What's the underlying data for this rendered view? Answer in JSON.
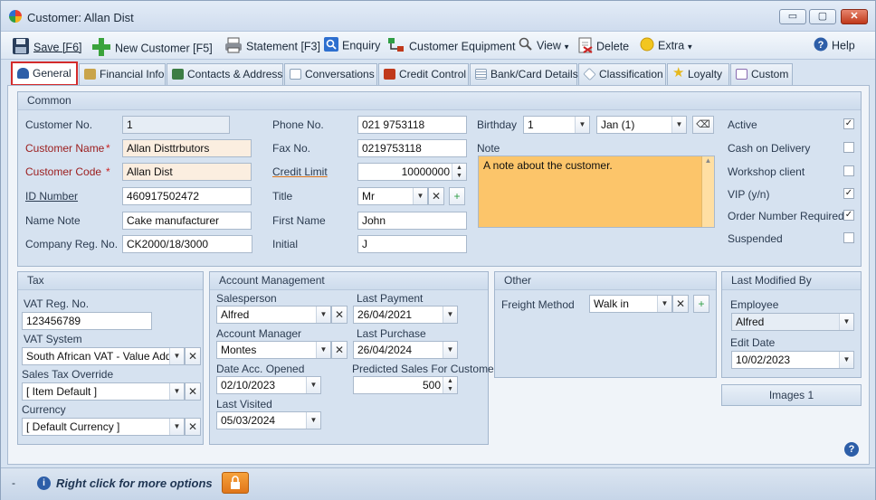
{
  "window": {
    "title": "Customer: Allan Dist",
    "minimize": "▭",
    "maximize": "▢",
    "close": "✕"
  },
  "toolbar": {
    "save": "Save [F6]",
    "new_customer": "New Customer [F5]",
    "statement": "Statement [F3]",
    "enquiry": "Enquiry",
    "customer_equipment": "Customer Equipment",
    "view": "View",
    "delete": "Delete",
    "extra": "Extra",
    "help": "Help"
  },
  "tabs": [
    {
      "label": "General",
      "icon": "person-icon",
      "color": "#2d5ea8"
    },
    {
      "label": "Financial Info",
      "icon": "building-icon",
      "color": "#c9a44a"
    },
    {
      "label": "Contacts & Address",
      "icon": "map-icon",
      "color": "#3c7d44"
    },
    {
      "label": "Conversations",
      "icon": "chat-icon",
      "color": "#8aa0b8"
    },
    {
      "label": "Credit Control",
      "icon": "lock-icon",
      "color": "#c0391b"
    },
    {
      "label": "Bank/Card Details",
      "icon": "grid-icon",
      "color": "#8aa0b8"
    },
    {
      "label": "Classification",
      "icon": "tag-icon",
      "color": "#8aa0b8"
    },
    {
      "label": "Loyalty",
      "icon": "star-icon",
      "color": "#e6b81c"
    },
    {
      "label": "Custom",
      "icon": "custom-icon",
      "color": "#8a6bb0"
    }
  ],
  "common": {
    "title": "Common",
    "customer_no_label": "Customer No.",
    "customer_no": "1",
    "customer_name_label": "Customer Name",
    "customer_name": "Allan Disttrbutors",
    "customer_code_label": "Customer Code",
    "customer_code": "Allan Dist",
    "id_number_label": "ID Number",
    "id_number": "460917502472",
    "name_note_label": "Name Note",
    "name_note": "Cake manufacturer",
    "company_reg_label": "Company Reg. No.",
    "company_reg": "CK2000/18/3000",
    "phone_label": "Phone No.",
    "phone": "021 9753118",
    "fax_label": "Fax No.",
    "fax": "0219753118",
    "credit_limit_label": "Credit Limit",
    "credit_limit": "10000000",
    "title_label": "Title",
    "title_value": "Mr",
    "first_name_label": "First Name",
    "first_name": "John",
    "initial_label": "Initial",
    "initial": "J",
    "birthday_label": "Birthday",
    "birthday_day": "1",
    "birthday_month": "Jan (1)",
    "note_label": "Note",
    "note": "A note about the customer.",
    "flags": [
      {
        "label": "Active",
        "checked": true
      },
      {
        "label": "Cash on Delivery",
        "checked": false
      },
      {
        "label": "Workshop client",
        "checked": false
      },
      {
        "label": "VIP (y/n)",
        "checked": true
      },
      {
        "label": "Order Number Required",
        "checked": true
      },
      {
        "label": "Suspended",
        "checked": false
      }
    ]
  },
  "tax": {
    "title": "Tax",
    "vat_reg_label": "VAT Reg. No.",
    "vat_reg": "123456789",
    "vat_system_label": "VAT System",
    "vat_system": "South African VAT - Value Add...",
    "sales_tax_label": "Sales Tax Override",
    "sales_tax": "[ Item Default ]",
    "currency_label": "Currency",
    "currency": "[ Default Currency ]"
  },
  "account": {
    "title": "Account Management",
    "salesperson_label": "Salesperson",
    "salesperson": "Alfred",
    "last_payment_label": "Last Payment",
    "last_payment": "26/04/2021",
    "account_manager_label": "Account Manager",
    "account_manager": "Montes",
    "last_purchase_label": "Last Purchase",
    "last_purchase": "26/04/2024",
    "date_opened_label": "Date Acc. Opened",
    "date_opened": "02/10/2023",
    "predicted_label": "Predicted Sales For Customer",
    "predicted": "500",
    "last_visited_label": "Last Visited",
    "last_visited": "05/03/2024"
  },
  "other": {
    "title": "Other",
    "freight_label": "Freight Method",
    "freight": "Walk in"
  },
  "modified": {
    "title": "Last Modified By",
    "employee_label": "Employee",
    "employee": "Alfred",
    "edit_date_label": "Edit Date",
    "edit_date": "10/02/2023"
  },
  "images_button": "Images 1",
  "status": {
    "dash": "-",
    "hint": "Right click for more options"
  },
  "colors": {
    "accent": "#2d5ea8",
    "required": "#9b1c1c",
    "note_bg": "#fcc56a",
    "lock": "#e0761a"
  }
}
